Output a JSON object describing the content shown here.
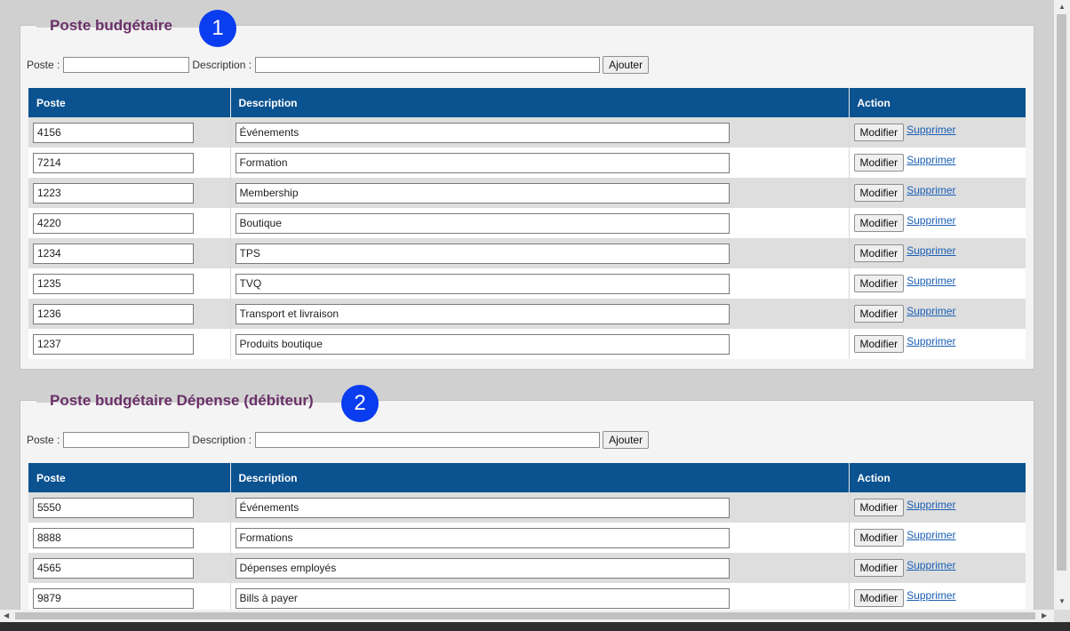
{
  "sections": [
    {
      "title": "Poste budgétaire",
      "badge": "1",
      "form": {
        "poste_label": "Poste :",
        "description_label": "Description :",
        "add_label": "Ajouter"
      },
      "headers": {
        "poste": "Poste",
        "description": "Description",
        "action": "Action"
      },
      "rows": [
        {
          "poste": "4156",
          "description": "Événements"
        },
        {
          "poste": "7214",
          "description": "Formation"
        },
        {
          "poste": "1223",
          "description": "Membership"
        },
        {
          "poste": "4220",
          "description": "Boutique"
        },
        {
          "poste": "1234",
          "description": "TPS"
        },
        {
          "poste": "1235",
          "description": "TVQ"
        },
        {
          "poste": "1236",
          "description": "Transport et livraison"
        },
        {
          "poste": "1237",
          "description": "Produits boutique"
        }
      ]
    },
    {
      "title": "Poste budgétaire Dépense (débiteur)",
      "badge": "2",
      "form": {
        "poste_label": "Poste :",
        "description_label": "Description :",
        "add_label": "Ajouter"
      },
      "headers": {
        "poste": "Poste",
        "description": "Description",
        "action": "Action"
      },
      "rows": [
        {
          "poste": "5550",
          "description": "Événements"
        },
        {
          "poste": "8888",
          "description": "Formations"
        },
        {
          "poste": "4565",
          "description": "Dépenses employés"
        },
        {
          "poste": "9879",
          "description": "Bills à payer"
        }
      ]
    }
  ],
  "actions": {
    "modify_label": "Modifier",
    "delete_label": "Supprimer"
  },
  "icons": {
    "scroll_up": "triangle-up-icon",
    "scroll_down": "triangle-down-icon",
    "scroll_left": "triangle-left-icon",
    "scroll_right": "triangle-right-icon"
  },
  "colors": {
    "header_bg": "#0b5290",
    "title": "#6a2f68",
    "badge": "#0a3cf0",
    "link": "#1a5fb4"
  }
}
